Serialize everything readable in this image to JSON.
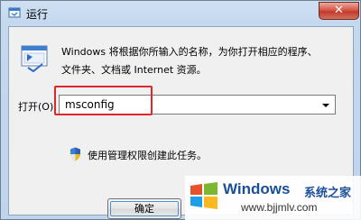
{
  "window": {
    "title": "运行",
    "close_label": "✕"
  },
  "dialog": {
    "description_line1": "Windows 将根据你所输入的名称，为你打开相应的程序、",
    "description_line2": "文件夹、文档或 Internet 资源。",
    "open_label": "打开(O):",
    "input_value": "msconfig",
    "admin_note": "使用管理权限创建此任务。",
    "ok_label": "确定"
  },
  "watermark": {
    "brand": "Windows",
    "sub": "系统之家",
    "url": "www.bjjmlv.com"
  },
  "colors": {
    "highlight": "#e0262a",
    "brand": "#1b4f9c"
  }
}
